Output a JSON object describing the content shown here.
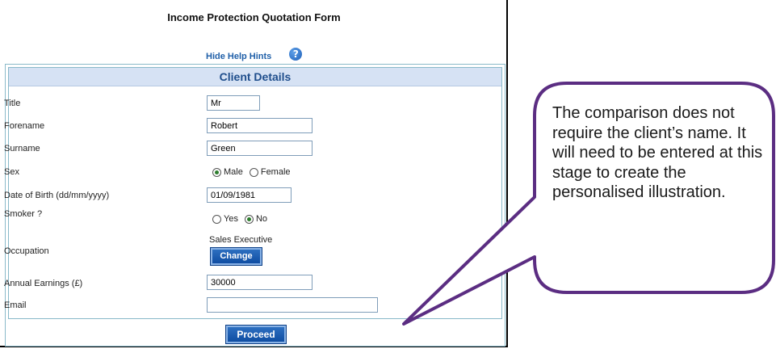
{
  "form": {
    "title": "Income Protection Quotation Form",
    "help_link": "Hide Help Hints",
    "help_icon": "?",
    "section_title": "Client Details",
    "fields": {
      "title": {
        "label": "Title",
        "value": "Mr"
      },
      "forename": {
        "label": "Forename",
        "value": "Robert"
      },
      "surname": {
        "label": "Surname",
        "value": "Green"
      },
      "sex": {
        "label": "Sex",
        "options": [
          "Male",
          "Female"
        ],
        "selected": "Male"
      },
      "dob": {
        "label": "Date of Birth (dd/mm/yyyy)",
        "value": "01/09/1981"
      },
      "smoker": {
        "label": "Smoker ?",
        "options": [
          "Yes",
          "No"
        ],
        "selected": "No"
      },
      "occupation": {
        "label": "Occupation",
        "value": "Sales Executive",
        "change_label": "Change"
      },
      "earnings": {
        "label": "Annual Earnings (£)",
        "value": "30000"
      },
      "email": {
        "label": "Email",
        "value": ""
      }
    },
    "proceed_label": "Proceed"
  },
  "callout": {
    "text": "The comparison does not require the client’s name. It will need to be entered at this stage to create the personalised illustration.",
    "border_color": "#5b2d82"
  }
}
